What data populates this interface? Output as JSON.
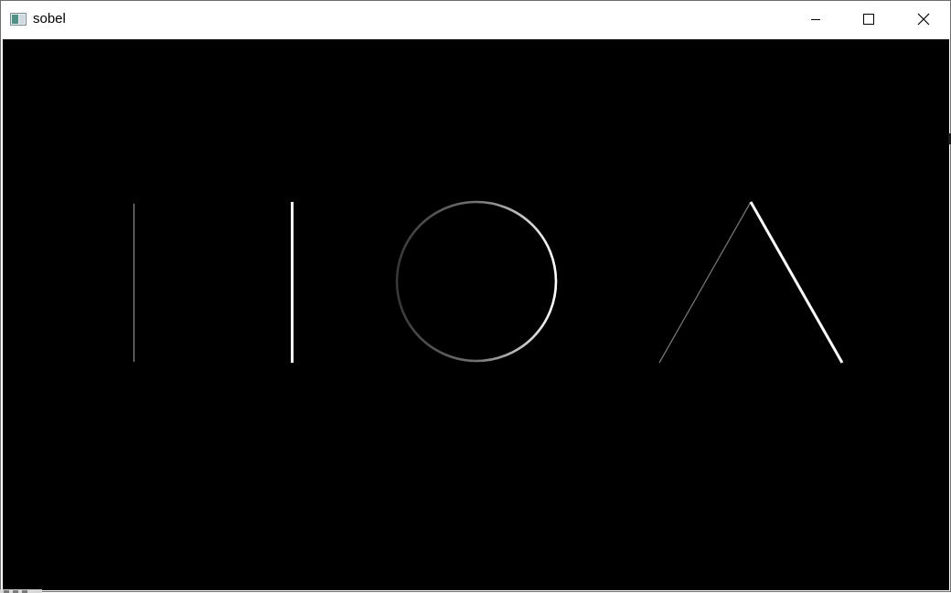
{
  "window": {
    "title": "sobel"
  },
  "caption_buttons": {
    "minimize": "minimize-icon",
    "maximize": "maximize-icon",
    "close": "close-icon"
  },
  "colors": {
    "titlebar_bg": "#ffffff",
    "canvas_bg": "#000000",
    "edge_color": "#ffffff"
  }
}
